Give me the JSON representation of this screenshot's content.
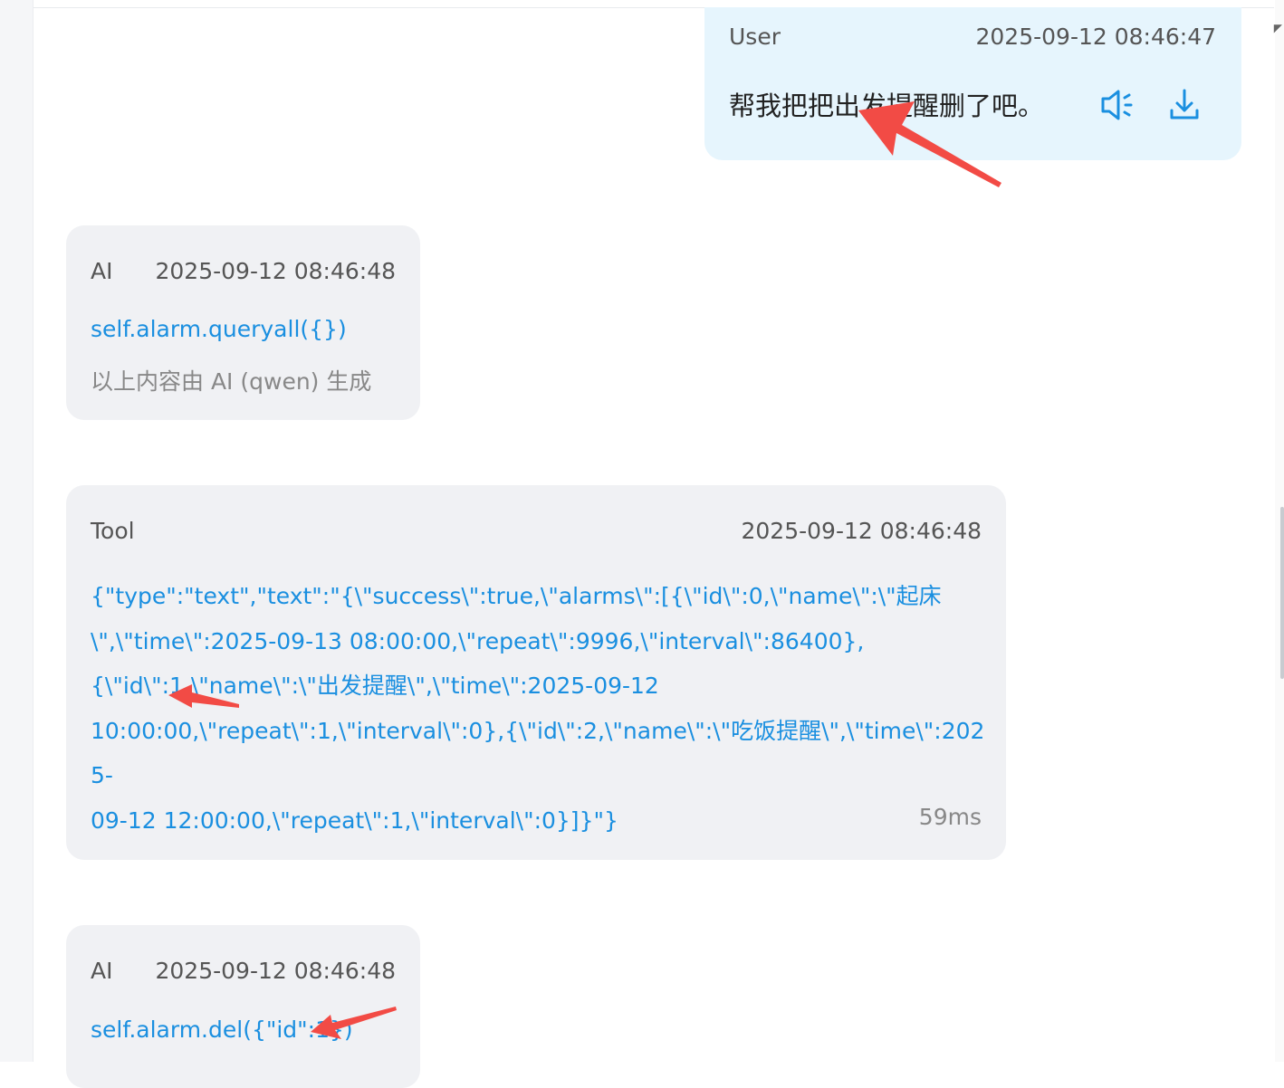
{
  "colors": {
    "accent": "#1a8fe0",
    "user_bubble": "#e6f5fd",
    "other_bubble": "#f0f1f4",
    "annotation_arrow": "#f24b45"
  },
  "messages": {
    "user": {
      "role": "User",
      "time": "2025-09-12 08:46:47",
      "text": "帮我把把出发提醒删了吧。",
      "icons": [
        "speaker-icon",
        "download-icon"
      ]
    },
    "ai1": {
      "role": "AI",
      "time": "2025-09-12 08:46:48",
      "call": "self.alarm.queryall({})",
      "note": "以上内容由 AI (qwen) 生成"
    },
    "tool": {
      "role": "Tool",
      "time": "2025-09-12 08:46:48",
      "lines": [
        "{\"type\":\"text\",\"text\":\"{\\\"success\\\":true,\\\"alarms\\\":[{\\\"id\\\":0,\\\"name\\\":\\\"起床",
        "\\\",\\\"time\\\":2025-09-13 08:00:00,\\\"repeat\\\":9996,\\\"interval\\\":86400},",
        "{\\\"id\\\":1,\\\"name\\\":\\\"出发提醒\\\",\\\"time\\\":2025-09-12",
        "10:00:00,\\\"repeat\\\":1,\\\"interval\\\":0},{\\\"id\\\":2,\\\"name\\\":\\\"吃饭提醒\\\",\\\"time\\\":2025-",
        "09-12 12:00:00,\\\"repeat\\\":1,\\\"interval\\\":0}]}\"}"
      ],
      "duration": "59ms"
    },
    "ai2": {
      "role": "AI",
      "time": "2025-09-12 08:46:48",
      "call": "self.alarm.del({\"id\":1})"
    }
  }
}
